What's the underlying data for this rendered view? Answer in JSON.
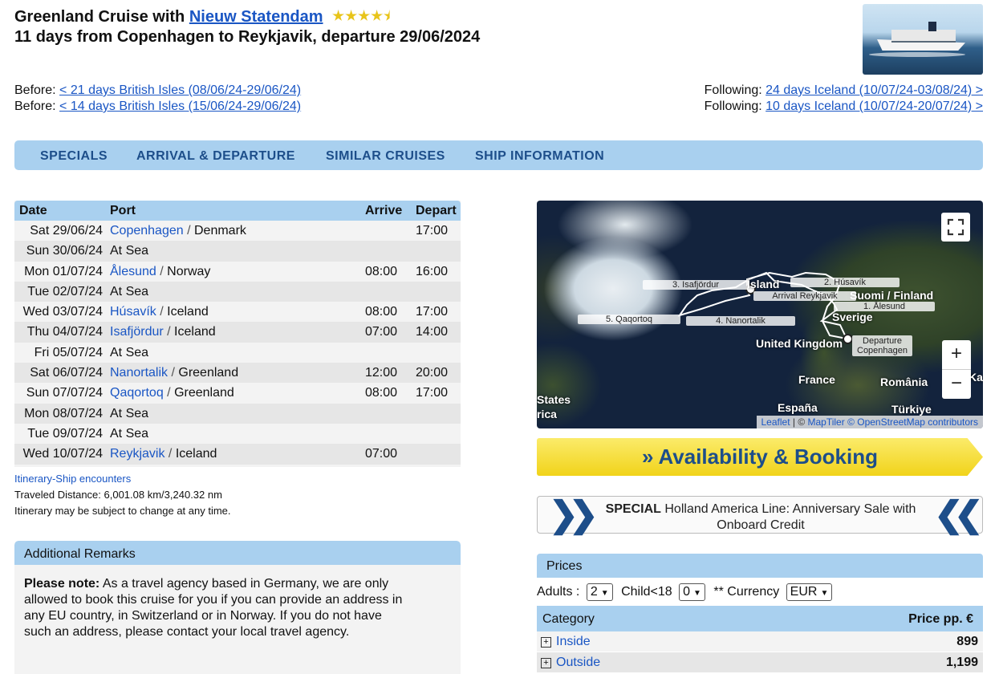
{
  "header": {
    "title_prefix": "Greenland Cruise with",
    "ship_name": "Nieuw Statendam",
    "rating": 4.5,
    "subtitle": "11 days from Copenhagen to Reykjavik, departure 29/06/2024"
  },
  "related": {
    "before_label": "Before:",
    "before": [
      "< 21 days British Isles (08/06/24-29/06/24)",
      "< 14 days British Isles (15/06/24-29/06/24)"
    ],
    "following_label": "Following:",
    "following": [
      "24 days Iceland (10/07/24-03/08/24) >",
      "10 days Iceland (10/07/24-20/07/24) >"
    ]
  },
  "tabs": [
    "SPECIALS",
    "ARRIVAL & DEPARTURE",
    "SIMILAR CRUISES",
    "SHIP INFORMATION"
  ],
  "itinerary": {
    "headers": {
      "date": "Date",
      "port": "Port",
      "arrive": "Arrive",
      "depart": "Depart"
    },
    "rows": [
      {
        "date": "Sat 29/06/24",
        "port": "Copenhagen",
        "country": "Denmark",
        "arrive": "",
        "depart": "17:00"
      },
      {
        "date": "Sun 30/06/24",
        "port": "At Sea",
        "country": "",
        "arrive": "",
        "depart": ""
      },
      {
        "date": "Mon 01/07/24",
        "port": "Ålesund",
        "country": "Norway",
        "arrive": "08:00",
        "depart": "16:00"
      },
      {
        "date": "Tue 02/07/24",
        "port": "At Sea",
        "country": "",
        "arrive": "",
        "depart": ""
      },
      {
        "date": "Wed 03/07/24",
        "port": "Húsavík",
        "country": "Iceland",
        "arrive": "08:00",
        "depart": "17:00"
      },
      {
        "date": "Thu 04/07/24",
        "port": "Isafjördur",
        "country": "Iceland",
        "arrive": "07:00",
        "depart": "14:00"
      },
      {
        "date": "Fri 05/07/24",
        "port": "At Sea",
        "country": "",
        "arrive": "",
        "depart": ""
      },
      {
        "date": "Sat 06/07/24",
        "port": "Nanortalik",
        "country": "Greenland",
        "arrive": "12:00",
        "depart": "20:00"
      },
      {
        "date": "Sun 07/07/24",
        "port": "Qaqortoq",
        "country": "Greenland",
        "arrive": "08:00",
        "depart": "17:00"
      },
      {
        "date": "Mon 08/07/24",
        "port": "At Sea",
        "country": "",
        "arrive": "",
        "depart": ""
      },
      {
        "date": "Tue 09/07/24",
        "port": "At Sea",
        "country": "",
        "arrive": "",
        "depart": ""
      },
      {
        "date": "Wed 10/07/24",
        "port": "Reykjavik",
        "country": "Iceland",
        "arrive": "07:00",
        "depart": ""
      }
    ],
    "ship_encounters_link": "Itinerary-Ship encounters",
    "distance": "Traveled Distance: 6,001.08 km/3,240.32 nm",
    "note": "Itinerary may be subject to change at any time."
  },
  "remarks": {
    "title": "Additional Remarks",
    "note_bold": "Please note:",
    "note_text": "As a travel agency based in Germany, we are only allowed to book this cruise for you if you can provide an address in any EU country, in Switzerland or in Norway. If you do not have such an address, please contact your local travel agency."
  },
  "map": {
    "labels": {
      "isafjordur": "3. Isafjördur",
      "husavik": "2. Húsavík",
      "arrival": "Arrival Reykjavik",
      "alesund": "1. Ålesund",
      "qaqortoq": "5. Qaqortoq",
      "nanortalik": "4. Nanortalik",
      "departure_1": "Departure",
      "departure_2": "Copenhagen"
    },
    "countries": {
      "island": "Ísland",
      "suomi": "Suomi / Finland",
      "sverige": "Sverige",
      "uk": "United Kingdom",
      "france": "France",
      "romania": "România",
      "espana": "España",
      "turkiye": "Türkiye",
      "states": "States",
      "rica": "rica",
      "kaz": "Kaz"
    },
    "zoom_in": "+",
    "zoom_out": "−",
    "attribution": {
      "leaflet": "Leaflet",
      "sep": " | © ",
      "maptiler": "MapTiler",
      "osm": "© OpenStreetMap contributors"
    }
  },
  "booking_button": "Availability & Booking",
  "special": {
    "label": "SPECIAL",
    "text": "Holland America Line: Anniversary Sale with Onboard Credit"
  },
  "prices": {
    "title": "Prices",
    "adults_label": "Adults :",
    "adults": "2",
    "child_label": "Child<18",
    "children": "0",
    "currency_label": "** Currency",
    "currency": "EUR",
    "category_header": "Category",
    "price_header": "Price pp. €",
    "categories": [
      {
        "name": "Inside",
        "price": "899"
      },
      {
        "name": "Outside",
        "price": "1,199"
      }
    ]
  },
  "colors": {
    "accent": "#a9d0ef",
    "link": "#1a56c4",
    "nav_text": "#1d4e8a",
    "button_yellow": "#f1d31a"
  }
}
